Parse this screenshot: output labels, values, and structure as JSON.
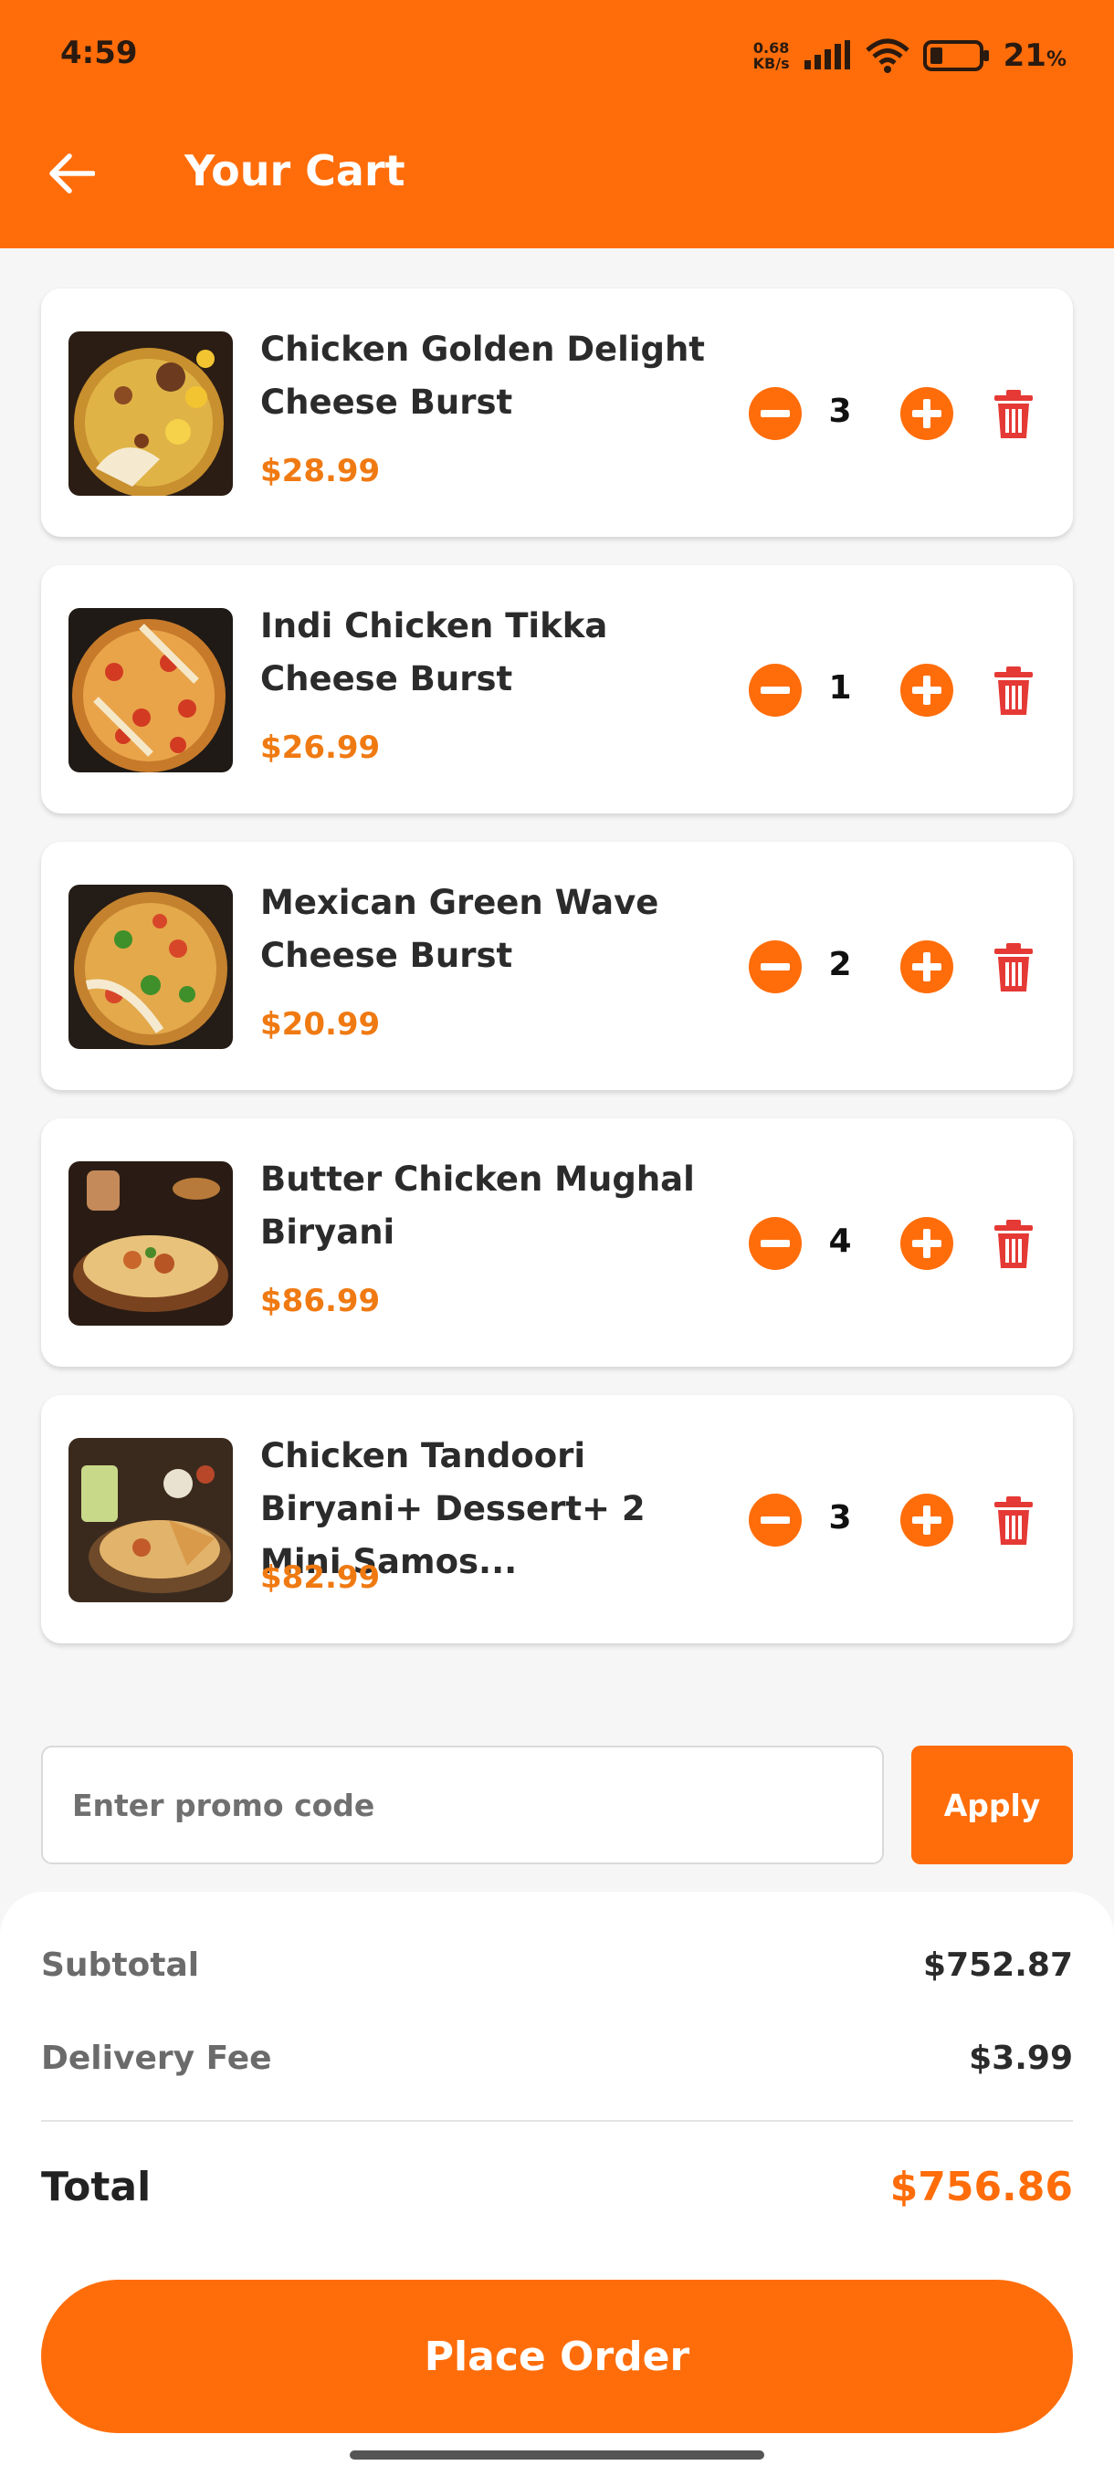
{
  "status_bar": {
    "time": "4:59",
    "net_speed_value": "0.68",
    "net_speed_unit": "KB/s",
    "battery_percent": "21",
    "battery_percent_sign": "%"
  },
  "header": {
    "title": "Your Cart",
    "back_icon": "arrow-left-icon"
  },
  "cart": {
    "items": [
      {
        "name": "Chicken Golden Delight Cheese Burst",
        "price": "$28.99",
        "quantity": "3"
      },
      {
        "name": "Indi Chicken Tikka Cheese Burst",
        "price": "$26.99",
        "quantity": "1"
      },
      {
        "name": "Mexican Green Wave Cheese Burst",
        "price": "$20.99",
        "quantity": "2"
      },
      {
        "name": "Butter Chicken Mughal Biryani",
        "price": "$86.99",
        "quantity": "4"
      },
      {
        "name": "Chicken Tandoori Biryani+ Dessert+ 2 Mini Samos...",
        "price": "$82.99",
        "quantity": "3"
      }
    ]
  },
  "promo": {
    "placeholder": "Enter promo code",
    "value": "",
    "apply_label": "Apply"
  },
  "summary": {
    "subtotal_label": "Subtotal",
    "subtotal_value": "$752.87",
    "delivery_label": "Delivery Fee",
    "delivery_value": "$3.99",
    "total_label": "Total",
    "total_value": "$756.86"
  },
  "actions": {
    "place_order_label": "Place Order"
  },
  "colors": {
    "accent": "#ff6d0a",
    "price": "#f07a12",
    "delete": "#e53935",
    "background": "#f6f6f6"
  }
}
